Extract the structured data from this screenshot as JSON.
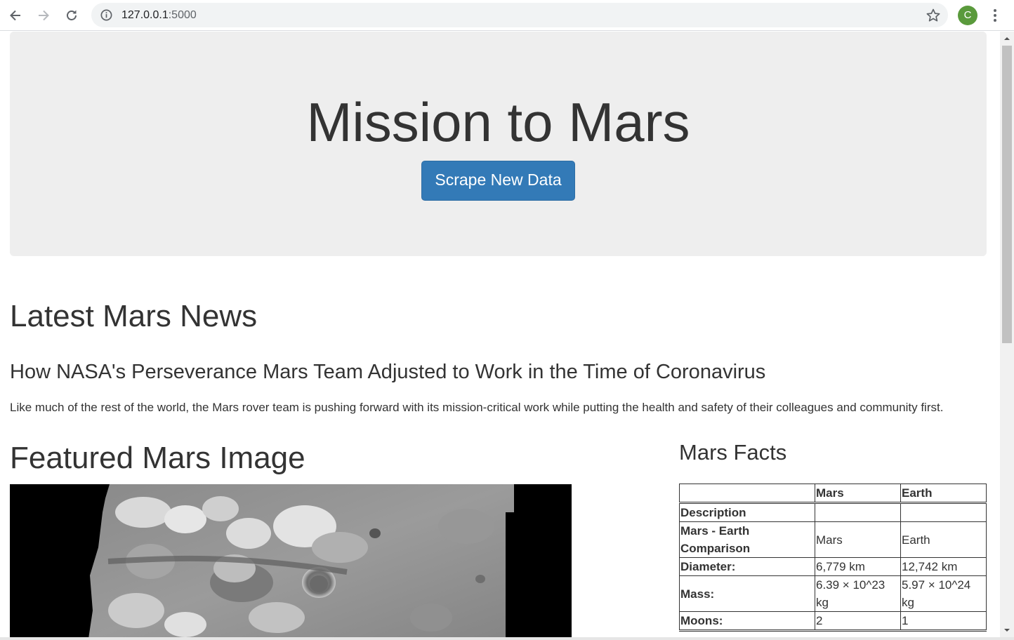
{
  "browser": {
    "url_host": "127.0.0.1",
    "url_port": ":5000",
    "avatar_letter": "C",
    "icons": [
      "back-arrow-icon",
      "forward-arrow-icon",
      "reload-icon",
      "info-icon",
      "bookmark-star-icon",
      "kebab-menu-icon"
    ]
  },
  "jumbotron": {
    "title": "Mission to Mars",
    "button_label": "Scrape New Data"
  },
  "news": {
    "heading": "Latest Mars News",
    "title": "How NASA's Perseverance Mars Team Adjusted to Work in the Time of Coronavirus",
    "paragraph": "Like much of the rest of the world, the Mars rover team is pushing forward with its mission-critical work while putting the health and safety of their colleagues and community first."
  },
  "featured": {
    "heading": "Featured Mars Image"
  },
  "facts": {
    "heading": "Mars Facts",
    "columns": [
      "",
      "Mars",
      "Earth"
    ],
    "rows": [
      {
        "label": "Description",
        "mars": "",
        "earth": ""
      },
      {
        "label": "Mars - Earth Comparison",
        "mars": "Mars",
        "earth": "Earth"
      },
      {
        "label": "Diameter:",
        "mars": "6,779 km",
        "earth": "12,742 km"
      },
      {
        "label": "Mass:",
        "mars": "6.39 × 10^23 kg",
        "earth": "5.97 × 10^24 kg"
      },
      {
        "label": "Moons:",
        "mars": "2",
        "earth": "1"
      }
    ]
  },
  "colors": {
    "button_primary": "#337ab7",
    "jumbotron_bg": "#eeeeee",
    "text": "#333333",
    "avatar": "#5a9a3c"
  }
}
